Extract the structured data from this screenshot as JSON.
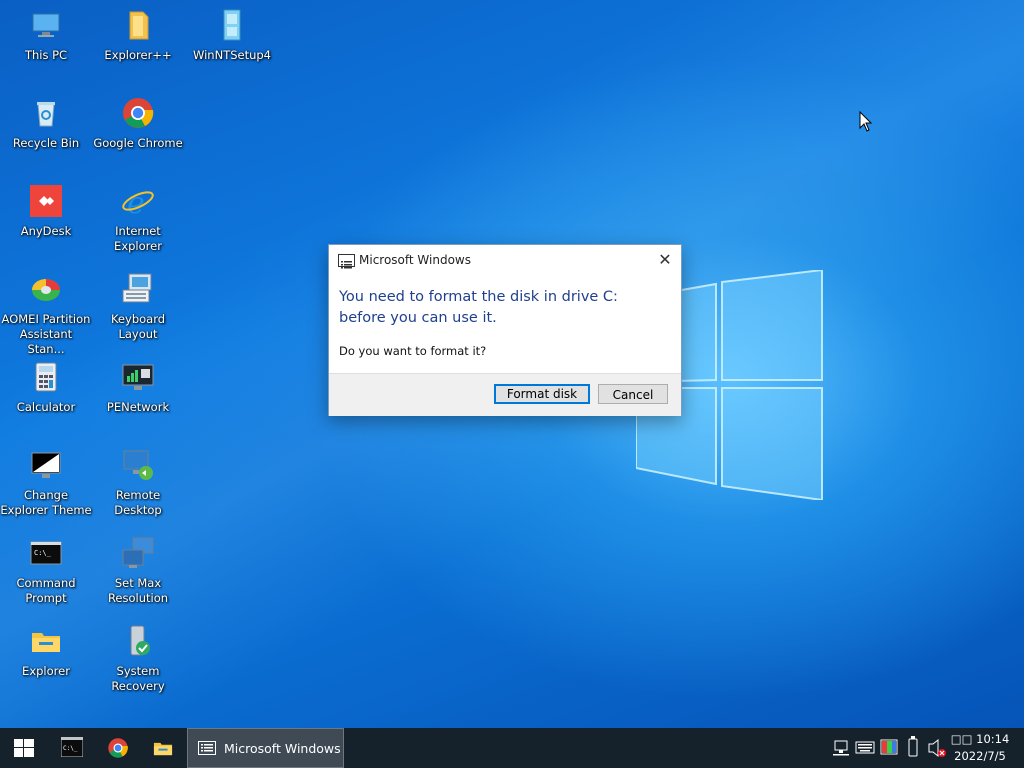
{
  "desktop": {
    "icons": [
      {
        "label": "This PC",
        "icon": "this-pc-icon"
      },
      {
        "label": "Explorer++",
        "icon": "folder-icon"
      },
      {
        "label": "WinNTSetup4",
        "icon": "winntsetup-icon"
      },
      {
        "label": "Recycle Bin",
        "icon": "recycle-bin-icon"
      },
      {
        "label": "Google Chrome",
        "icon": "chrome-icon"
      },
      {
        "label": "AnyDesk",
        "icon": "anydesk-icon"
      },
      {
        "label": "Internet Explorer",
        "icon": "internet-explorer-icon"
      },
      {
        "label": "AOMEI Partition Assistant Stan...",
        "icon": "aomei-icon"
      },
      {
        "label": "Keyboard Layout",
        "icon": "keyboard-icon"
      },
      {
        "label": "Calculator",
        "icon": "calculator-icon"
      },
      {
        "label": "PENetwork",
        "icon": "network-icon"
      },
      {
        "label": "Change Explorer Theme",
        "icon": "theme-icon"
      },
      {
        "label": "Remote Desktop",
        "icon": "remote-desktop-icon"
      },
      {
        "label": "Command Prompt",
        "icon": "cmd-icon"
      },
      {
        "label": "Set Max Resolution",
        "icon": "resolution-icon"
      },
      {
        "label": "Explorer",
        "icon": "explorer-folder-icon"
      },
      {
        "label": "System Recovery",
        "icon": "recovery-icon"
      }
    ]
  },
  "dialog": {
    "title": "Microsoft Windows",
    "close_glyph": "✕",
    "heading": "You need to format the disk in drive C: before you can use it.",
    "question": "Do you want to format it?",
    "format_button": "Format disk",
    "cancel_button": "Cancel"
  },
  "taskbar": {
    "active_window_label": "Microsoft Windows",
    "clock_time": "□□ 10:14",
    "clock_date": "2022/7/5"
  },
  "colors": {
    "accent": "#0078d7",
    "taskbar_bg": "#15212b",
    "heading_text": "#1f3f8f"
  }
}
